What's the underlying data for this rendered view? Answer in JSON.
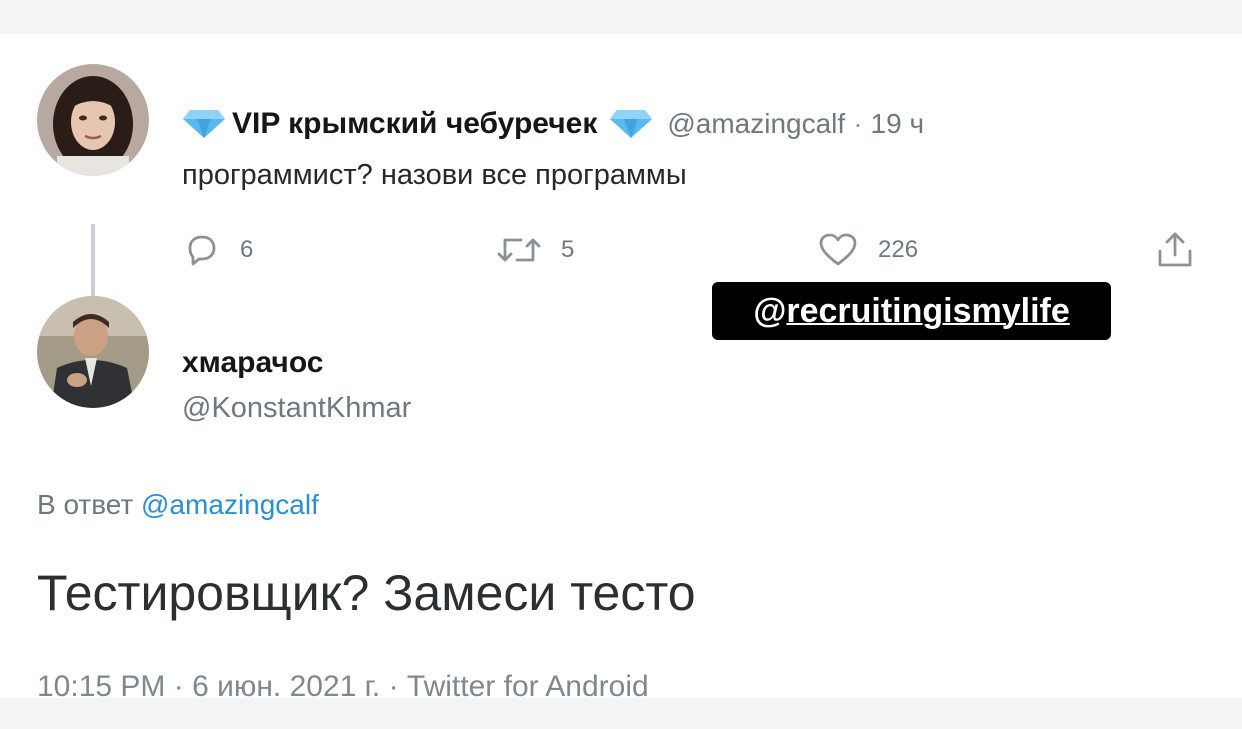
{
  "tweet1": {
    "display_name": "VIP крымский чебуречек",
    "handle": "@amazingcalf",
    "separator": "·",
    "time": "19 ч",
    "text": "программист? назови все программы",
    "actions": {
      "replies": "6",
      "retweets": "5",
      "likes": "226"
    }
  },
  "watermark": {
    "at": "@",
    "handle": "recruitingismylife"
  },
  "tweet2": {
    "display_name": "хмарачос",
    "handle": "@KonstantKhmar",
    "reply_prefix": "В ответ",
    "reply_to": "@amazingcalf",
    "text": "Тестировщик? Замеси тесто",
    "footer": "10:15 PM · 6 июн. 2021 г. · Twitter for Android"
  },
  "icons": {
    "name_badge": "diamond-icon",
    "reply": "reply-icon",
    "retweet": "retweet-icon",
    "like": "heart-icon",
    "share": "share-icon"
  },
  "colors": {
    "diamond": "#5ab8ee",
    "link": "#2a8fd4",
    "muted": "#70787f"
  }
}
